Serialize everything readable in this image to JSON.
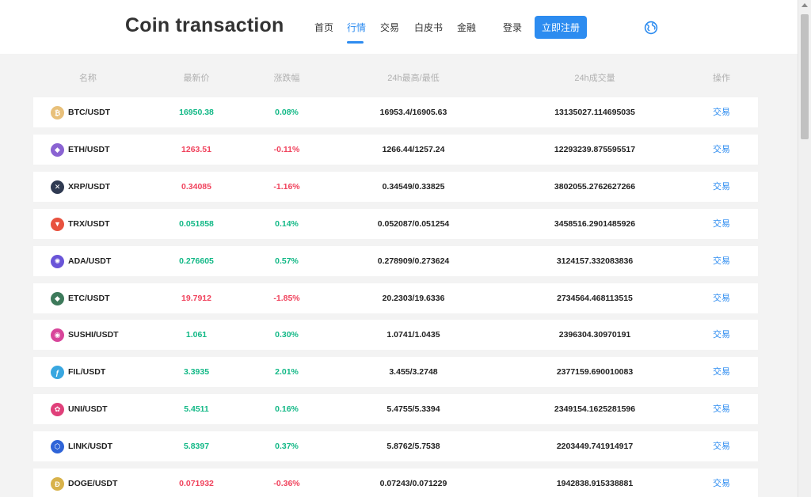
{
  "header": {
    "brand": "Coin transaction",
    "nav": [
      {
        "label": "首页",
        "active": false
      },
      {
        "label": "行情",
        "active": true
      },
      {
        "label": "交易",
        "active": false
      },
      {
        "label": "白皮书",
        "active": false
      },
      {
        "label": "金融",
        "active": false
      }
    ],
    "login_label": "登录",
    "register_label": "立即注册",
    "globe_icon": "globe-icon",
    "accent_color": "#2d8cf0"
  },
  "table": {
    "headers": {
      "name": "名称",
      "price": "最新价",
      "change": "涨跌幅",
      "high_low": "24h最高/最低",
      "volume": "24h成交量",
      "action": "操作"
    },
    "up_color": "#12b886",
    "down_color": "#f0435d",
    "rows": [
      {
        "pair": "BTC/USDT",
        "icon": "btc-icon",
        "price": "16950.38",
        "change": "0.08%",
        "trend": "up",
        "high_low": "16953.4/16905.63",
        "volume": "13135027.114695035",
        "action": "交易"
      },
      {
        "pair": "ETH/USDT",
        "icon": "eth-icon",
        "price": "1263.51",
        "change": "-0.11%",
        "trend": "down",
        "high_low": "1266.44/1257.24",
        "volume": "12293239.875595517",
        "action": "交易"
      },
      {
        "pair": "XRP/USDT",
        "icon": "xrp-icon",
        "price": "0.34085",
        "change": "-1.16%",
        "trend": "down",
        "high_low": "0.34549/0.33825",
        "volume": "3802055.2762627266",
        "action": "交易"
      },
      {
        "pair": "TRX/USDT",
        "icon": "trx-icon",
        "price": "0.051858",
        "change": "0.14%",
        "trend": "up",
        "high_low": "0.052087/0.051254",
        "volume": "3458516.2901485926",
        "action": "交易"
      },
      {
        "pair": "ADA/USDT",
        "icon": "ada-icon",
        "price": "0.276605",
        "change": "0.57%",
        "trend": "up",
        "high_low": "0.278909/0.273624",
        "volume": "3124157.332083836",
        "action": "交易"
      },
      {
        "pair": "ETC/USDT",
        "icon": "etc-icon",
        "price": "19.7912",
        "change": "-1.85%",
        "trend": "down",
        "high_low": "20.2303/19.6336",
        "volume": "2734564.468113515",
        "action": "交易"
      },
      {
        "pair": "SUSHI/USDT",
        "icon": "sushi-icon",
        "price": "1.061",
        "change": "0.30%",
        "trend": "up",
        "high_low": "1.0741/1.0435",
        "volume": "2396304.30970191",
        "action": "交易"
      },
      {
        "pair": "FIL/USDT",
        "icon": "fil-icon",
        "price": "3.3935",
        "change": "2.01%",
        "trend": "up",
        "high_low": "3.455/3.2748",
        "volume": "2377159.690010083",
        "action": "交易"
      },
      {
        "pair": "UNI/USDT",
        "icon": "uni-icon",
        "price": "5.4511",
        "change": "0.16%",
        "trend": "up",
        "high_low": "5.4755/5.3394",
        "volume": "2349154.1625281596",
        "action": "交易"
      },
      {
        "pair": "LINK/USDT",
        "icon": "link-icon",
        "price": "5.8397",
        "change": "0.37%",
        "trend": "up",
        "high_low": "5.8762/5.7538",
        "volume": "2203449.741914917",
        "action": "交易"
      },
      {
        "pair": "DOGE/USDT",
        "icon": "doge-icon",
        "price": "0.071932",
        "change": "-0.36%",
        "trend": "down",
        "high_low": "0.07243/0.071229",
        "volume": "1942838.915338881",
        "action": "交易"
      }
    ]
  }
}
